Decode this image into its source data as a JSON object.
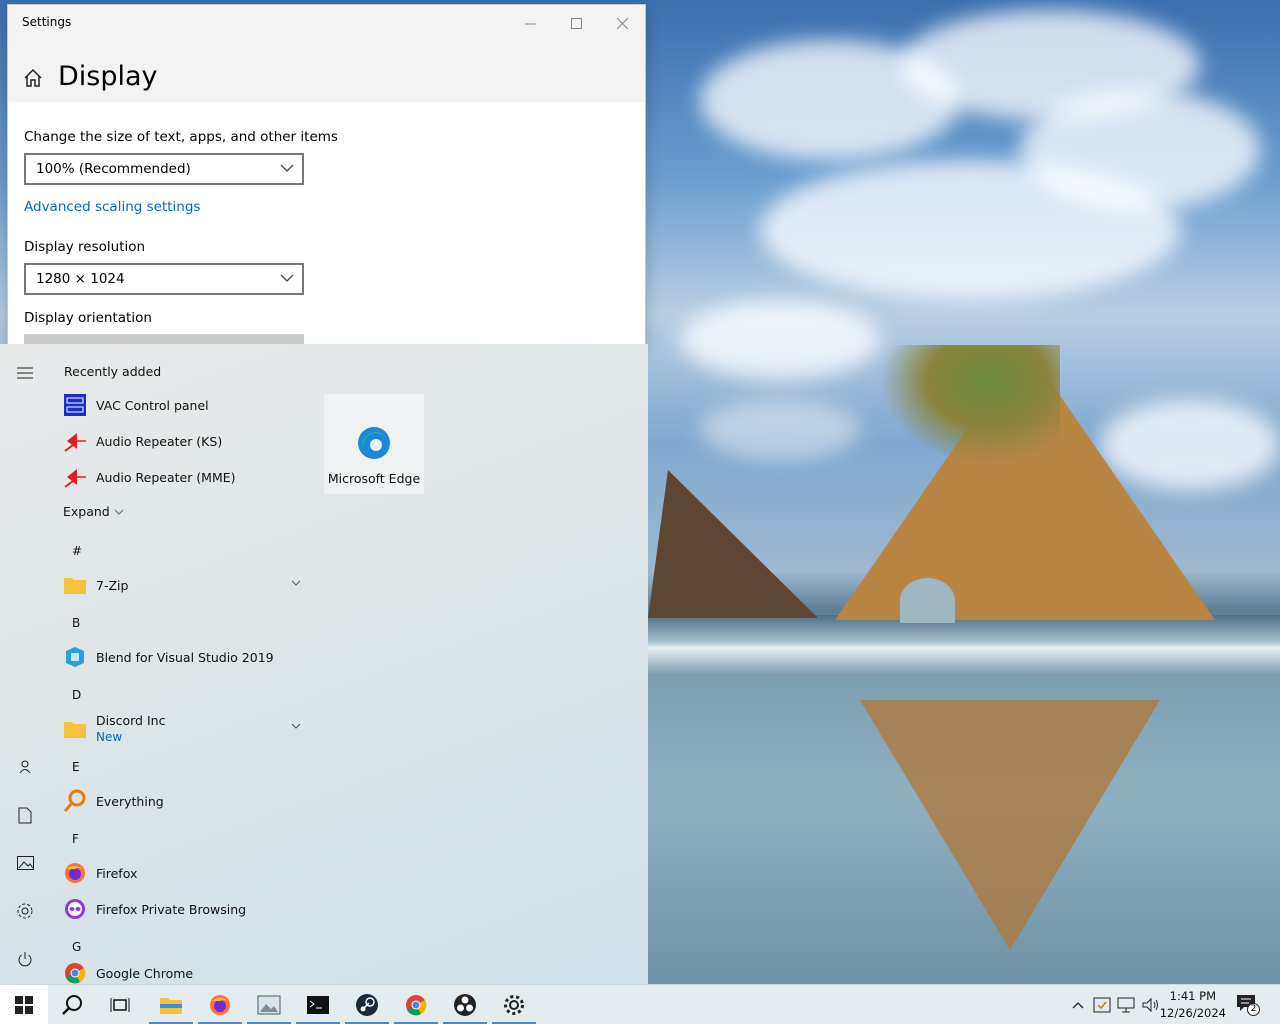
{
  "settings": {
    "window_title": "Settings",
    "page_title": "Display",
    "scale_label": "Change the size of text, apps, and other items",
    "scale_value": "100% (Recommended)",
    "advanced_link": "Advanced scaling settings",
    "resolution_label": "Display resolution",
    "resolution_value": "1280 × 1024",
    "orientation_label": "Display orientation"
  },
  "start_menu": {
    "recently_added_header": "Recently added",
    "expand_label": "Expand",
    "recent": [
      {
        "name": "VAC Control panel",
        "icon": "vac-icon"
      },
      {
        "name": "Audio Repeater (KS)",
        "icon": "audio-repeater-icon"
      },
      {
        "name": "Audio Repeater (MME)",
        "icon": "audio-repeater-icon"
      }
    ],
    "letters": {
      "hash": "#",
      "b": "B",
      "d": "D",
      "e": "E",
      "f": "F",
      "g": "G"
    },
    "apps": {
      "zip": {
        "name": "7-Zip",
        "icon": "folder-icon"
      },
      "blend": {
        "name": "Blend for Visual Studio 2019",
        "icon": "blend-icon"
      },
      "discord": {
        "name": "Discord Inc",
        "sub": "New",
        "icon": "folder-icon"
      },
      "everything": {
        "name": "Everything",
        "icon": "everything-icon"
      },
      "firefox": {
        "name": "Firefox",
        "icon": "firefox-icon"
      },
      "firefox_private": {
        "name": "Firefox Private Browsing",
        "icon": "firefox-private-icon"
      },
      "chrome": {
        "name": "Google Chrome",
        "icon": "chrome-icon"
      }
    },
    "tile": {
      "name": "Microsoft Edge",
      "icon": "edge-icon"
    }
  },
  "taskbar": {
    "time": "1:41 PM",
    "date": "12/26/2024",
    "notification_count": "2",
    "accent": "#4a88d0"
  }
}
